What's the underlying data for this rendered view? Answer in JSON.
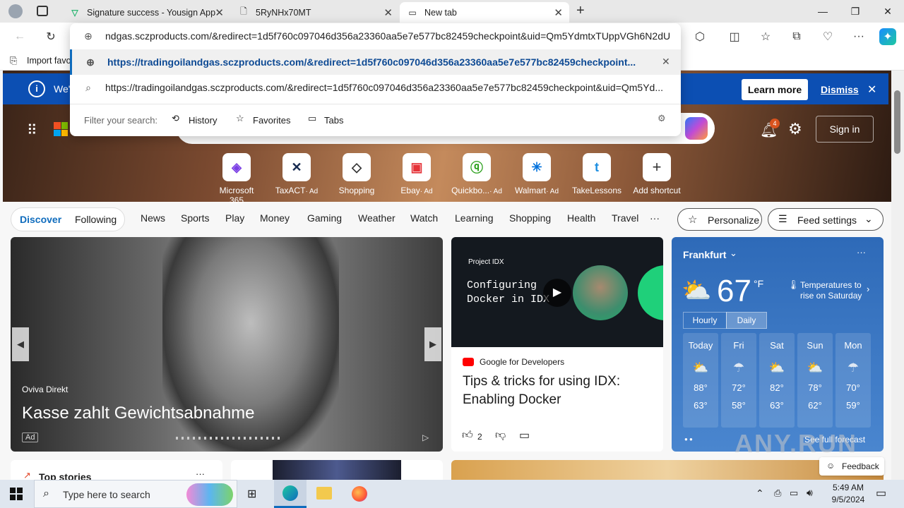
{
  "tabs": [
    {
      "title": "Signature success - Yousign App"
    },
    {
      "title": "5RyNHx70MT"
    },
    {
      "title": "New tab"
    }
  ],
  "omnibox": {
    "input_value": "ndgas.sczproducts.com/&redirect=1d5f760c097046d356a23360aa5e7e577bc82459checkpoint&uid=Qm5YdmtxTUppVGh6N2dU",
    "suggestion_1": "https://tradingoilandgas.sczproducts.com/&redirect=1d5f760c097046d356a23360aa5e7e577bc82459checkpoint...",
    "suggestion_2": "https://tradingoilandgas.sczproducts.com/&redirect=1d5f760c097046d356a23360aa5e7e577bc82459checkpoint&uid=Qm5Yd...",
    "filter_label": "Filter your search:",
    "filters": [
      "History",
      "Favorites",
      "Tabs"
    ]
  },
  "favbar": {
    "import": "Import favo"
  },
  "banner": {
    "text": "We'",
    "learn_more": "Learn more",
    "dismiss": "Dismiss"
  },
  "header": {
    "sign_in": "Sign in",
    "notif_count": "4"
  },
  "shortcuts": [
    {
      "label": "Microsoft 365"
    },
    {
      "label": "TaxACT",
      "ad": "· Ad"
    },
    {
      "label": "Shopping"
    },
    {
      "label": "Ebay",
      "ad": "· Ad"
    },
    {
      "label": "Quickbo...",
      "ad": "· Ad"
    },
    {
      "label": "Walmart",
      "ad": "· Ad"
    },
    {
      "label": "TakeLessons"
    },
    {
      "label": "Add shortcut"
    }
  ],
  "nav": {
    "discover": "Discover",
    "following": "Following",
    "items": [
      "News",
      "Sports",
      "Play",
      "Money",
      "Gaming",
      "Weather",
      "Watch",
      "Learning",
      "Shopping",
      "Health",
      "Travel"
    ],
    "more": "···",
    "personalize": "Personalize",
    "feed_settings": "Feed settings"
  },
  "hero_card": {
    "source": "Oviva Direkt",
    "title": "Kasse zahlt Gewichtsabnahme",
    "ad": "Ad"
  },
  "video_card": {
    "badge": "Project IDX",
    "video_text_1": "Configuring",
    "video_text_2": "Docker in IDX",
    "source": "Google for Developers",
    "title": "Tips & tricks for using IDX: Enabling Docker",
    "likes": "2"
  },
  "weather": {
    "city": "Frankfurt",
    "temp": "67",
    "unit": "°F",
    "note": "Temperatures to rise on Saturday",
    "tab_hourly": "Hourly",
    "tab_daily": "Daily",
    "days": [
      {
        "name": "Today",
        "high": "88°",
        "low": "63°"
      },
      {
        "name": "Fri",
        "high": "72°",
        "low": "58°"
      },
      {
        "name": "Sat",
        "high": "82°",
        "low": "63°"
      },
      {
        "name": "Sun",
        "high": "78°",
        "low": "62°"
      },
      {
        "name": "Mon",
        "high": "70°",
        "low": "59°"
      }
    ],
    "full_forecast": "See full forecast"
  },
  "lower": {
    "top_stories": "Top stories",
    "feedback": "Feedback"
  },
  "taskbar": {
    "search": "Type here to search",
    "time": "5:49 AM",
    "date": "9/5/2024"
  },
  "watermark": "ANY.RUN"
}
